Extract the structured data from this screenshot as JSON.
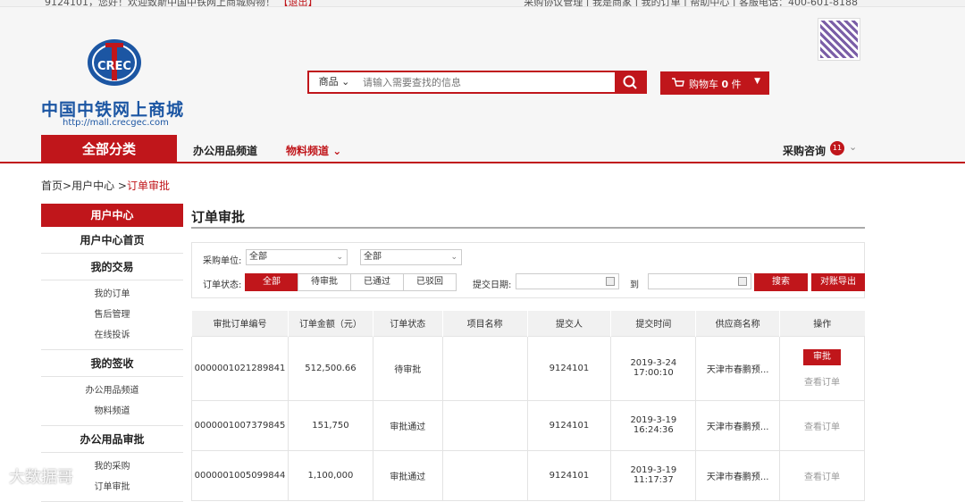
{
  "topbar": {
    "greeting": "9124101，您好！欢迎致斯中国中铁网上商城购物！",
    "exit": "【退出】",
    "right_links": "采购协议管理 | 我是商家 | 我的订单 | 帮助中心 | 客服电话：400-601-8188"
  },
  "logo": {
    "mark": "CREC",
    "name": "中国中铁网上商城",
    "url": "http://mall.crecgec.com"
  },
  "search": {
    "category": "商品",
    "placeholder": "请输入需要查找的信息"
  },
  "cart": {
    "label": "购物车",
    "count": "0",
    "unit": "件"
  },
  "nav": {
    "all_categories": "全部分类",
    "office": "办公用品频道",
    "materials": "物料频道",
    "consult": "采购咨询",
    "consult_badge": "11"
  },
  "breadcrumb": {
    "home": "首页",
    "user_center": "用户中心",
    "current": "订单审批"
  },
  "sidebar": {
    "header": "用户中心",
    "home": "用户中心首页",
    "sections": [
      {
        "title": "我的交易",
        "items": [
          "我的订单",
          "售后管理",
          "在线投诉"
        ]
      },
      {
        "title": "我的签收",
        "items": [
          "办公用品频道",
          "物料频道"
        ]
      },
      {
        "title": "办公用品审批",
        "items": [
          "我的采购",
          "订单审批"
        ]
      }
    ]
  },
  "page": {
    "title": "订单审批"
  },
  "filter": {
    "buyer_label": "采购单位:",
    "buyer_value1": "全部",
    "buyer_value2": "全部",
    "status_label": "订单状态:",
    "status_tabs": [
      "全部",
      "待审批",
      "已通过",
      "已驳回"
    ],
    "date_label": "提交日期:",
    "to": "到",
    "search_button": "搜索",
    "export_button": "对账导出"
  },
  "table": {
    "columns": [
      "审批订单编号",
      "订单金额（元）",
      "订单状态",
      "项目名称",
      "提交人",
      "提交时间",
      "供应商名称",
      "操作"
    ],
    "rows": [
      {
        "id": "0000001021289841",
        "amount": "512,500.66",
        "status": "待审批",
        "project": "",
        "submitter": "9124101",
        "date": "2019-3-24",
        "time": "17:00:10",
        "supplier": "天津市春鹏预...",
        "approve": "审批",
        "view": "查看订单"
      },
      {
        "id": "0000001007379845",
        "amount": "151,750",
        "status": "审批通过",
        "project": "",
        "submitter": "9124101",
        "date": "2019-3-19",
        "time": "16:24:36",
        "supplier": "天津市春鹏预...",
        "approve": "",
        "view": "查看订单"
      },
      {
        "id": "0000001005099844",
        "amount": "1,100,000",
        "status": "审批通过",
        "project": "",
        "submitter": "9124101",
        "date": "2019-3-19",
        "time": "11:17:37",
        "supplier": "天津市春鹏预...",
        "approve": "",
        "view": "查看订单"
      }
    ]
  },
  "watermark": "大数据哥",
  "colors": {
    "accent": "#c0161b",
    "brand_blue": "#1c56a3"
  }
}
